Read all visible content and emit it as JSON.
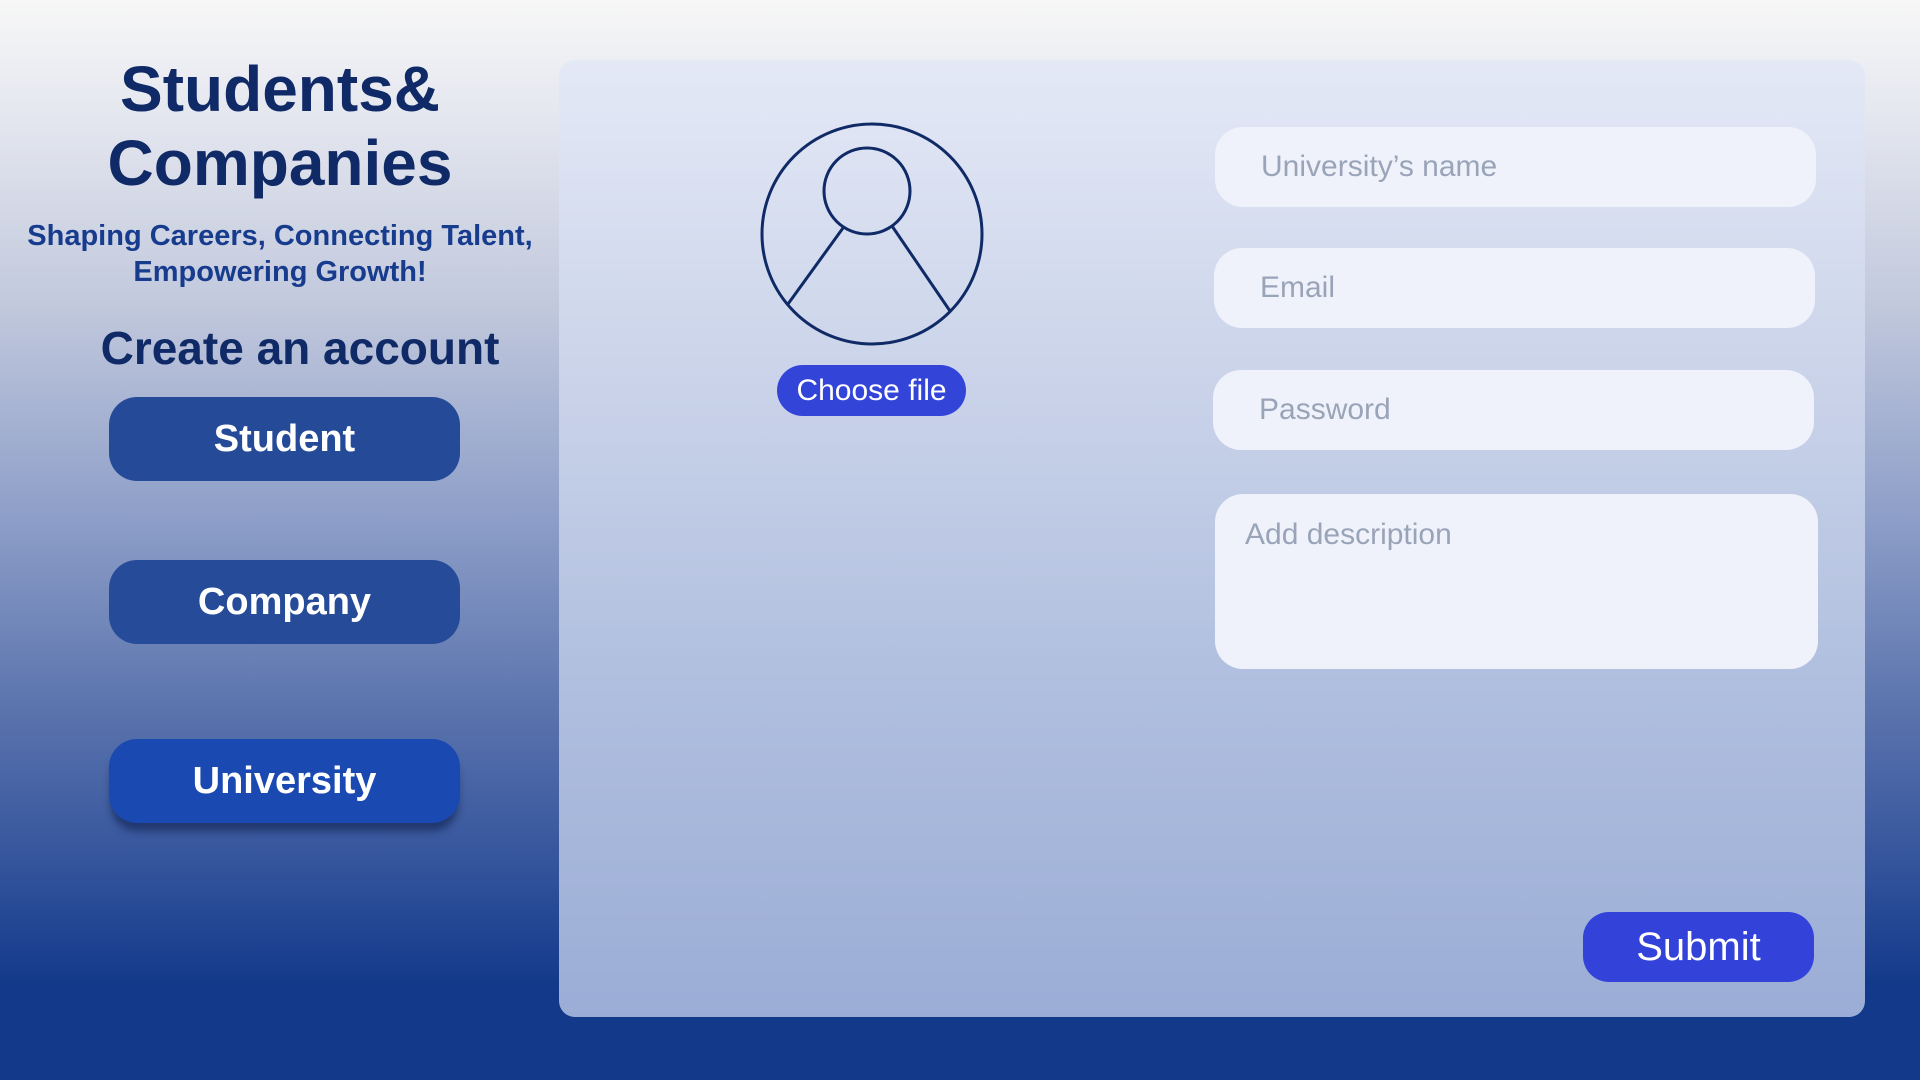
{
  "brand": {
    "title_line1": "Students&",
    "title_line2": "Companies",
    "tagline_line1": "Shaping Careers, Connecting Talent,",
    "tagline_line2": "Empowering Growth!"
  },
  "signup": {
    "title": "Create an account",
    "roles": [
      {
        "label": "Student"
      },
      {
        "label": "Company"
      },
      {
        "label": "University"
      }
    ],
    "selected_role": "University"
  },
  "form": {
    "avatar_icon": "user-avatar-icon",
    "choose_file_label": "Choose file",
    "university_name": {
      "placeholder": "University’s name",
      "value": ""
    },
    "email": {
      "placeholder": "Email",
      "value": ""
    },
    "password": {
      "placeholder": "Password",
      "value": ""
    },
    "description": {
      "placeholder": "Add description",
      "value": ""
    },
    "submit_label": "Submit"
  },
  "colors": {
    "heading": "#0f2a66",
    "role_button": "#254a97",
    "role_button_selected": "#1a49b1",
    "accent_button": "#3344d8",
    "field_background": "#eff2fb"
  }
}
